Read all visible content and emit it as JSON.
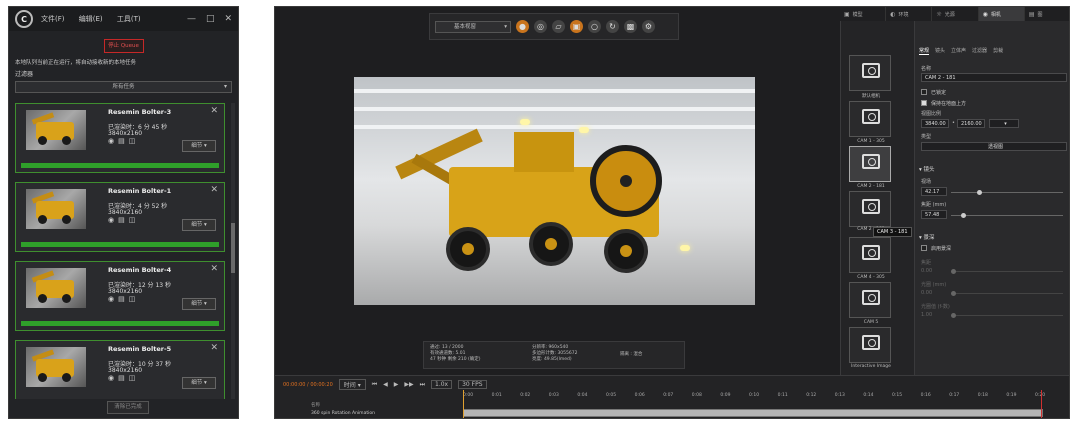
{
  "queue": {
    "menu": [
      "文件(F)",
      "编辑(E)",
      "工具(T)"
    ],
    "pause_label": "停止 Queue",
    "note": "本地队列当前正在运行，将自动接收新的本地任务",
    "filter_label": "过滤器",
    "filter_value": "所有任务",
    "jobs": [
      {
        "name": "Resemin Bolter-3",
        "elapsed": "已渲染时：6 分 45 秒",
        "resolution": "3840x2160",
        "detail": "细节",
        "progress": 1.0
      },
      {
        "name": "Resemin Bolter-1",
        "elapsed": "已渲染时：4 分 52 秒",
        "resolution": "3840x2160",
        "detail": "细节",
        "progress": 1.0
      },
      {
        "name": "Resemin Bolter-4",
        "elapsed": "已渲染时：12 分 13 秒",
        "resolution": "3840x2160",
        "detail": "细节",
        "progress": 1.0
      },
      {
        "name": "Resemin Bolter-5",
        "elapsed": "已渲染时：10 分 37 秒",
        "resolution": "3840x2160",
        "detail": "细节",
        "progress": 1.0
      }
    ],
    "clear_label": "清除已完成"
  },
  "toolbar": {
    "camera_select": "基本视窗"
  },
  "infobar": {
    "col1": [
      "通过: 13 / 2000",
      "有效通道数: 5.01",
      "47 秒钟 剩余 210 (确定)"
    ],
    "col2": [
      "分辨率: 960x540",
      "多边形计数: 3055672",
      "亮度: 49.85(lmed)"
    ],
    "col3": [
      "隔离 : 混合"
    ]
  },
  "panel_tabs": [
    "模型",
    "环境",
    "光源",
    "相机",
    "图"
  ],
  "cameras": [
    {
      "label": "默认相机"
    },
    {
      "label": "CAM 1 - 305"
    },
    {
      "label": "CAM 2 - 181"
    },
    {
      "label": "CAM 2 - 181"
    },
    {
      "label": "CAM 4 - 305"
    },
    {
      "label": "CAM 5"
    },
    {
      "label": "Interactive Image"
    }
  ],
  "tooltip": "CAM 3 - 181",
  "props": {
    "tabs": [
      "常规",
      "镜头",
      "立体声",
      "过滤器",
      "剪裁"
    ],
    "name_label": "名称",
    "name_value": "CAM 2 - 181",
    "locked_label": "已锁定",
    "keep_up_label": "保持在地面上方",
    "aspect_label": "视图比例",
    "aspect_w": "3840.00",
    "aspect_h": "2160.00",
    "type_label": "类型",
    "type_value": "透视图",
    "lens_section": "镜头",
    "focal_label": "视场",
    "focal_value": "42.17",
    "focal_mm_label": "焦距 (mm)",
    "focal_mm_value": "57.48",
    "depth_section": "景深",
    "depth_enable": "启用景深",
    "d1": "焦距",
    "d2": "光圈 (mm)",
    "d3": "光圈值 (f-数)",
    "d1v": "0.00",
    "d2v": "0.00",
    "d3v": "1.00"
  },
  "timeline": {
    "timecode": "00:00:00 / 00:00:20",
    "track_header": "名称",
    "track_name": "360 spin Rotation Animation",
    "fps": "30 FPS",
    "speed": "1.0x",
    "mode": "时间",
    "ticks": [
      "0:00",
      "0:01",
      "0:02",
      "0:03",
      "0:04",
      "0:05",
      "0:06",
      "0:07",
      "0:08",
      "0:09",
      "0:10",
      "0:11",
      "0:12",
      "0:13",
      "0:14",
      "0:15",
      "0:16",
      "0:17",
      "0:18",
      "0:19",
      "0:20"
    ]
  }
}
